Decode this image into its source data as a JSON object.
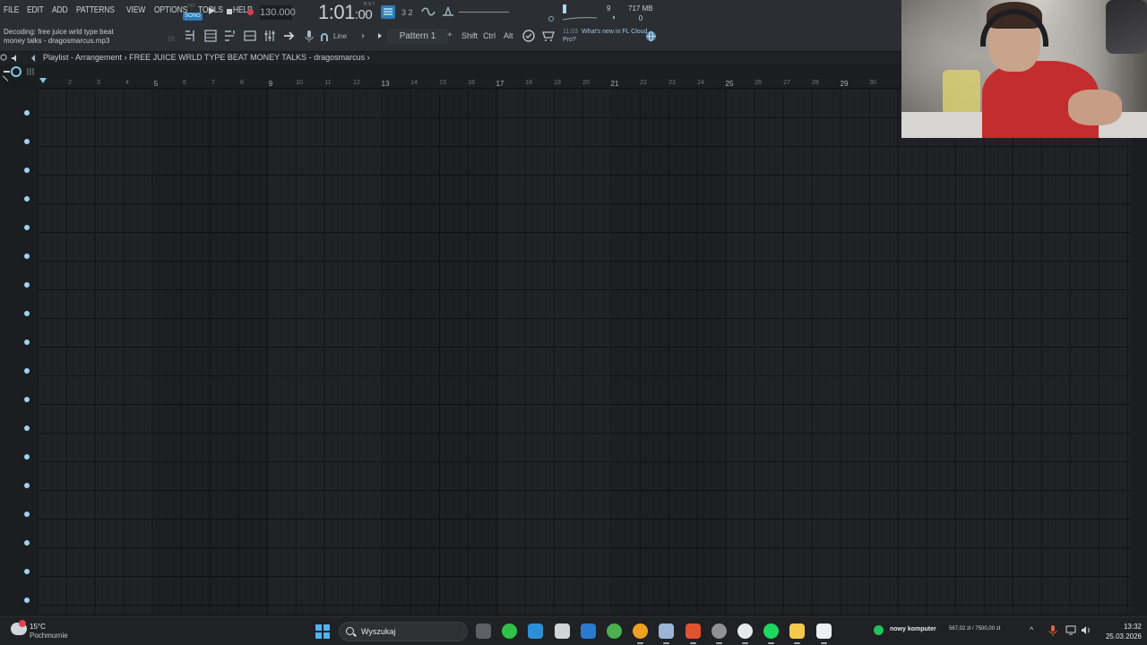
{
  "menu": [
    "FILE",
    "EDIT",
    "ADD",
    "PATTERNS",
    "VIEW",
    "OPTIONS",
    "TOOLS",
    "HELP"
  ],
  "transport": {
    "mode_pat": "PAT",
    "mode_song": "SONG",
    "tempo": "130.000",
    "time_main": "1:01",
    "time_sub": ":00",
    "time_unit": "B:S:T"
  },
  "memory": {
    "value": "717 MB",
    "cpu": "9",
    "polyphony": "0"
  },
  "hint": {
    "line1": "Decoding: free juice wrld type beat",
    "line2": "money talks - dragosmarcus.mp3"
  },
  "tools": {
    "snap": "Line",
    "pattern": "Pattern 1",
    "plus": "+",
    "shift": "Shift",
    "ctrl": "Ctrl",
    "alt": "Alt"
  },
  "news": {
    "time": "11:03",
    "text": "What's new in FL Cloud Pro?"
  },
  "playlist": {
    "title": "Playlist - Arrangement",
    "separator": "›",
    "project": "FREE JUICE WRLD TYPE BEAT MONEY TALKS - dragosmarcus",
    "end": "›"
  },
  "ruler": [
    "2",
    "3",
    "4",
    "5",
    "6",
    "7",
    "8",
    "9",
    "10",
    "11",
    "12",
    "13",
    "14",
    "15",
    "16",
    "17",
    "18",
    "19",
    "20",
    "21",
    "22",
    "23",
    "24",
    "25",
    "26",
    "27",
    "28",
    "29",
    "30"
  ],
  "ruler_major": [
    "5",
    "9",
    "13",
    "17",
    "21",
    "25",
    "29"
  ],
  "tracks_count": 18,
  "taskbar": {
    "temp": "15°C",
    "weather": "Pochmurnie",
    "search": "Wyszukaj",
    "status_label": "nowy komputer",
    "budget": "567,02 zł / 7500,00 zł",
    "time": "13:32",
    "date": "25.03.2026",
    "apps": [
      {
        "name": "task-view-icon",
        "color": "#5d6166"
      },
      {
        "name": "messenger-icon",
        "color": "#31c14a"
      },
      {
        "name": "vscode-icon",
        "color": "#2d8fd6"
      },
      {
        "name": "mail-icon",
        "color": "#d2d5d8"
      },
      {
        "name": "store-icon",
        "color": "#2a7ad0"
      },
      {
        "name": "chrome-icon",
        "color": "#4caf50"
      },
      {
        "name": "fl-studio-icon",
        "color": "#f0a020"
      },
      {
        "name": "steam-icon",
        "color": "#9ab8d6"
      },
      {
        "name": "brave-icon",
        "color": "#e0532f"
      },
      {
        "name": "obs-icon",
        "color": "#8e9296"
      },
      {
        "name": "github-icon",
        "color": "#e7eaec"
      },
      {
        "name": "spotify-icon",
        "color": "#1ed760"
      },
      {
        "name": "explorer-icon",
        "color": "#f3c94b"
      },
      {
        "name": "document-icon",
        "color": "#eef0f2"
      }
    ]
  },
  "colors": {
    "accent": "#7ec8e8",
    "song_button": "#2f7bb8",
    "record": "#d44050"
  }
}
